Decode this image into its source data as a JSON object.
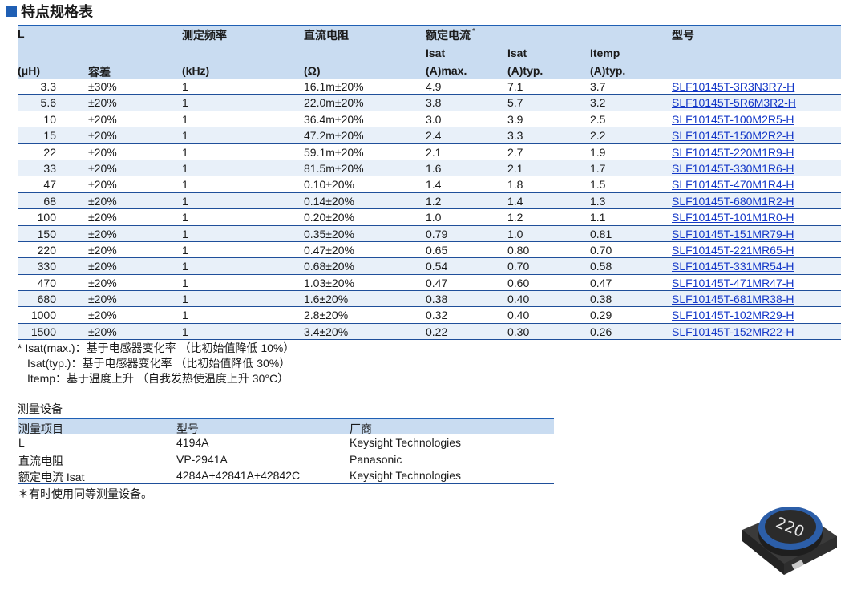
{
  "section_title": "特点规格表",
  "spec_table": {
    "headers": {
      "l_top": "L",
      "l_unit": "(μH)",
      "tolerance": "容差",
      "freq": "测定频率",
      "freq_unit": "(kHz)",
      "dcr": "直流电阻",
      "dcr_unit": "(Ω)",
      "rated_current": "额定电流",
      "rated_mark": "*",
      "isat_max": "Isat",
      "isat_max_unit": "(A)max.",
      "isat_typ": "Isat",
      "isat_typ_unit": "(A)typ.",
      "itemp": "Itemp",
      "itemp_unit": "(A)typ.",
      "part_number": "型号"
    },
    "rows": [
      {
        "l": "3.3",
        "tol": "±30%",
        "freq": "1",
        "dcr": "16.1m±20%",
        "isat_max": "4.9",
        "isat_typ": "7.1",
        "itemp": "3.7",
        "pn": "SLF10145T-3R3N3R7-H"
      },
      {
        "l": "5.6",
        "tol": "±20%",
        "freq": "1",
        "dcr": "22.0m±20%",
        "isat_max": "3.8",
        "isat_typ": "5.7",
        "itemp": "3.2",
        "pn": "SLF10145T-5R6M3R2-H"
      },
      {
        "l": "10",
        "tol": "±20%",
        "freq": "1",
        "dcr": "36.4m±20%",
        "isat_max": "3.0",
        "isat_typ": "3.9",
        "itemp": "2.5",
        "pn": "SLF10145T-100M2R5-H"
      },
      {
        "l": "15",
        "tol": "±20%",
        "freq": "1",
        "dcr": "47.2m±20%",
        "isat_max": "2.4",
        "isat_typ": "3.3",
        "itemp": "2.2",
        "pn": "SLF10145T-150M2R2-H"
      },
      {
        "l": "22",
        "tol": "±20%",
        "freq": "1",
        "dcr": "59.1m±20%",
        "isat_max": "2.1",
        "isat_typ": "2.7",
        "itemp": "1.9",
        "pn": "SLF10145T-220M1R9-H"
      },
      {
        "l": "33",
        "tol": "±20%",
        "freq": "1",
        "dcr": "81.5m±20%",
        "isat_max": "1.6",
        "isat_typ": "2.1",
        "itemp": "1.7",
        "pn": "SLF10145T-330M1R6-H"
      },
      {
        "l": "47",
        "tol": "±20%",
        "freq": "1",
        "dcr": "0.10±20%",
        "isat_max": "1.4",
        "isat_typ": "1.8",
        "itemp": "1.5",
        "pn": "SLF10145T-470M1R4-H"
      },
      {
        "l": "68",
        "tol": "±20%",
        "freq": "1",
        "dcr": "0.14±20%",
        "isat_max": "1.2",
        "isat_typ": "1.4",
        "itemp": "1.3",
        "pn": "SLF10145T-680M1R2-H"
      },
      {
        "l": "100",
        "tol": "±20%",
        "freq": "1",
        "dcr": "0.20±20%",
        "isat_max": "1.0",
        "isat_typ": "1.2",
        "itemp": "1.1",
        "pn": "SLF10145T-101M1R0-H"
      },
      {
        "l": "150",
        "tol": "±20%",
        "freq": "1",
        "dcr": "0.35±20%",
        "isat_max": "0.79",
        "isat_typ": "1.0",
        "itemp": "0.81",
        "pn": "SLF10145T-151MR79-H"
      },
      {
        "l": "220",
        "tol": "±20%",
        "freq": "1",
        "dcr": "0.47±20%",
        "isat_max": "0.65",
        "isat_typ": "0.80",
        "itemp": "0.70",
        "pn": "SLF10145T-221MR65-H"
      },
      {
        "l": "330",
        "tol": "±20%",
        "freq": "1",
        "dcr": "0.68±20%",
        "isat_max": "0.54",
        "isat_typ": "0.70",
        "itemp": "0.58",
        "pn": "SLF10145T-331MR54-H"
      },
      {
        "l": "470",
        "tol": "±20%",
        "freq": "1",
        "dcr": "1.03±20%",
        "isat_max": "0.47",
        "isat_typ": "0.60",
        "itemp": "0.47",
        "pn": "SLF10145T-471MR47-H"
      },
      {
        "l": "680",
        "tol": "±20%",
        "freq": "1",
        "dcr": "1.6±20%",
        "isat_max": "0.38",
        "isat_typ": "0.40",
        "itemp": "0.38",
        "pn": "SLF10145T-681MR38-H"
      },
      {
        "l": "1000",
        "tol": "±20%",
        "freq": "1",
        "dcr": "2.8±20%",
        "isat_max": "0.32",
        "isat_typ": "0.40",
        "itemp": "0.29",
        "pn": "SLF10145T-102MR29-H"
      },
      {
        "l": "1500",
        "tol": "±20%",
        "freq": "1",
        "dcr": "3.4±20%",
        "isat_max": "0.22",
        "isat_typ": "0.30",
        "itemp": "0.26",
        "pn": "SLF10145T-152MR22-H"
      }
    ]
  },
  "notes": [
    "* Isat(max.)：基于电感器变化率 （比初始值降低 10%）",
    "Isat(typ.)：基于电感器变化率 （比初始值降低 30%）",
    "Itemp：基于温度上升 （自我发热使温度上升 30°C）"
  ],
  "equipment": {
    "title": "测量设备",
    "headers": [
      "测量项目",
      "型号",
      "厂商"
    ],
    "rows": [
      [
        "L",
        "4194A",
        "Keysight Technologies"
      ],
      [
        "直流电阻",
        "VP-2941A",
        "Panasonic"
      ],
      [
        "额定电流 Isat",
        "4284A+42841A+42842C",
        "Keysight Technologies"
      ]
    ],
    "note": "＊有时使用同等测量设备。"
  },
  "product_image": {
    "marking": "220",
    "colors": {
      "body": "#2b2b2b",
      "ring": "#2c5ea8"
    }
  },
  "colors": {
    "accent": "#1f5fb4",
    "header_bg": "#c9dcf1",
    "row_alt": "#e8f0f9",
    "link": "#1438c8"
  }
}
